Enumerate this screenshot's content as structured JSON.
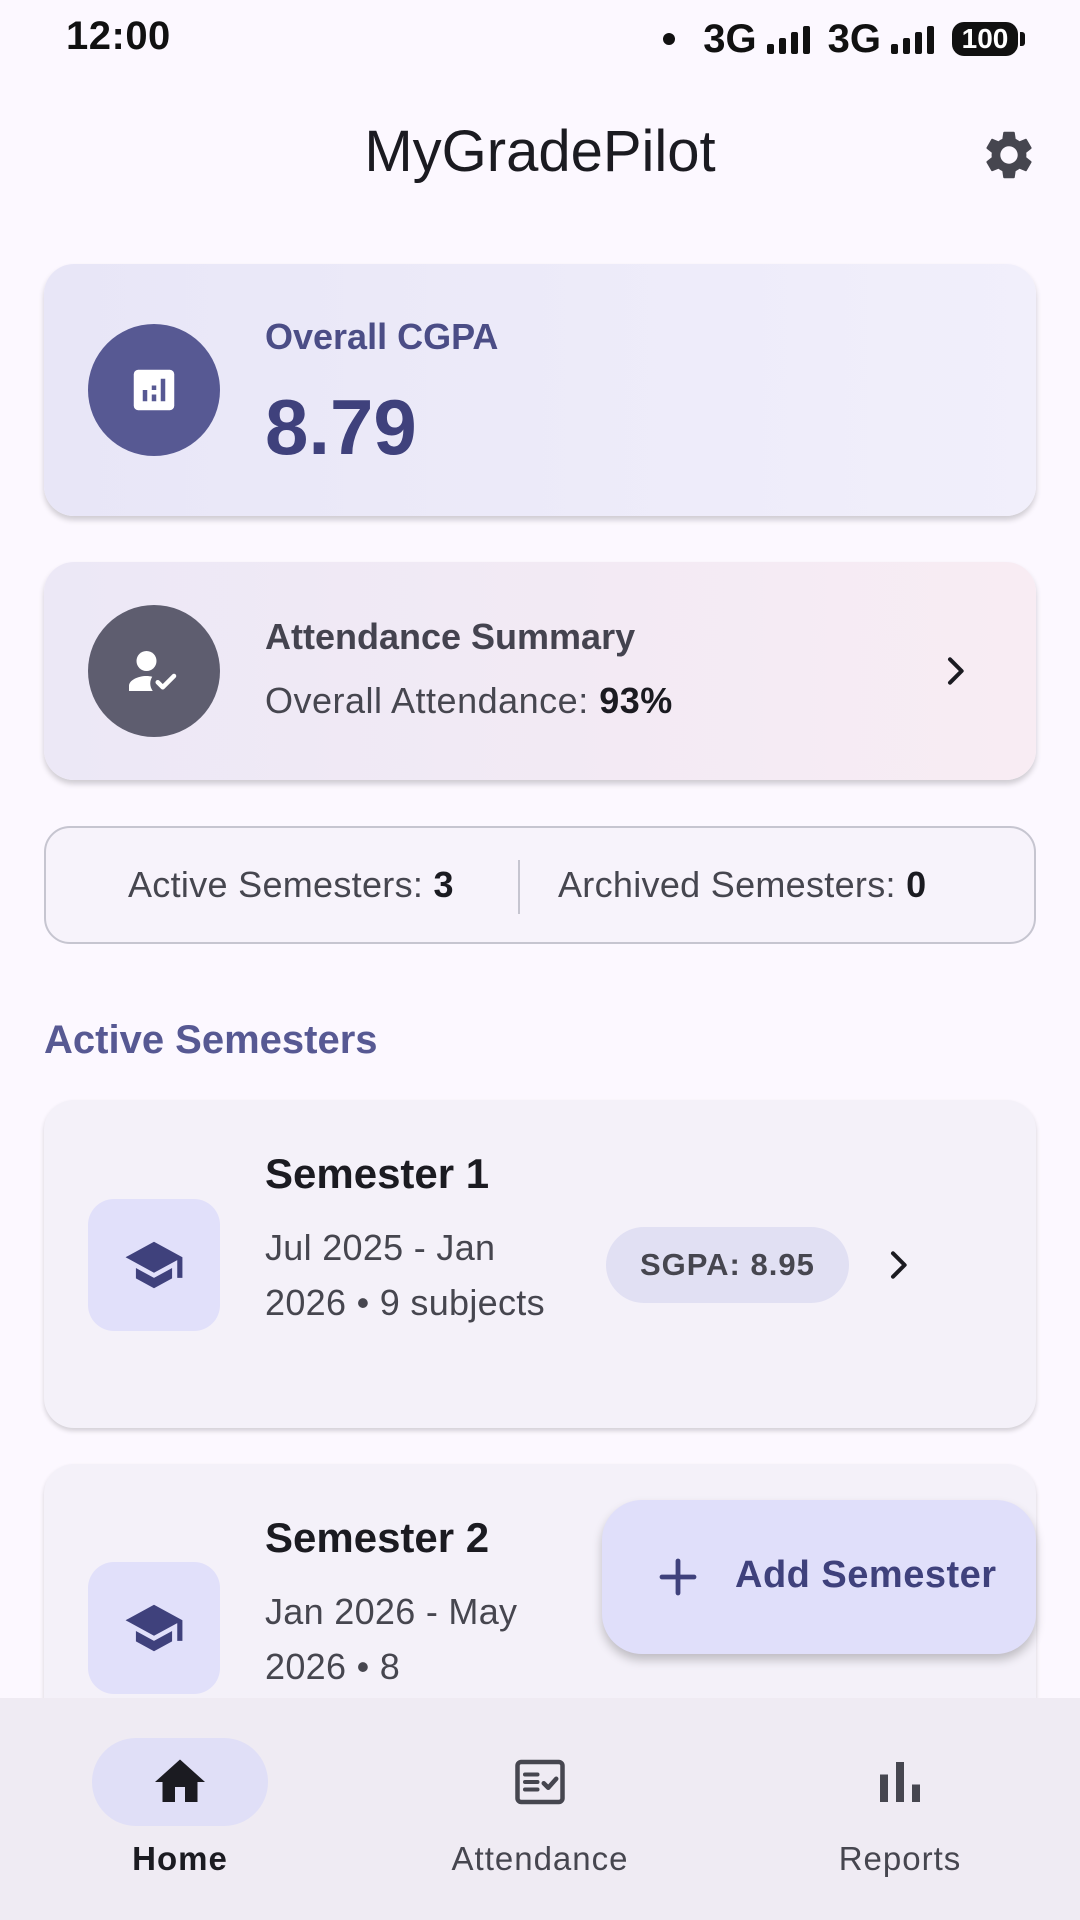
{
  "status_bar": {
    "time": "12:00",
    "network_1": "3G",
    "network_2": "3G",
    "battery": "100"
  },
  "app_bar": {
    "title": "MyGradePilot",
    "settings_icon": "gear-icon"
  },
  "cgpa": {
    "label": "Overall CGPA",
    "value": "8.79",
    "icon": "analytics-icon"
  },
  "attendance": {
    "title": "Attendance Summary",
    "overall_label": "Overall Attendance: ",
    "overall_value": "93%",
    "icon": "person-check-icon"
  },
  "summary": {
    "active_label": "Active Semesters: ",
    "active_count": "3",
    "archived_label": "Archived Semesters: ",
    "archived_count": "0"
  },
  "section": {
    "active_title": "Active Semesters"
  },
  "semesters": [
    {
      "name": "Semester 1",
      "detail": "Jul 2025 - Jan 2026 • 9 subjects",
      "sgpa": "SGPA: 8.95"
    },
    {
      "name": "Semester 2",
      "detail": "Jan 2026 - May 2026 • 8"
    }
  ],
  "fab": {
    "label": "Add Semester",
    "icon": "plus-icon"
  },
  "bottom_nav": {
    "items": [
      {
        "label": "Home",
        "icon": "home-icon",
        "active": true
      },
      {
        "label": "Attendance",
        "icon": "checklist-icon",
        "active": false
      },
      {
        "label": "Reports",
        "icon": "bar-chart-icon",
        "active": false
      }
    ]
  },
  "colors": {
    "primary": "#575993",
    "background": "#fcf8ff",
    "card_tint": "#e8e6f7",
    "chip_bg": "#e1e0f3",
    "nav_bg": "#efebf3"
  }
}
